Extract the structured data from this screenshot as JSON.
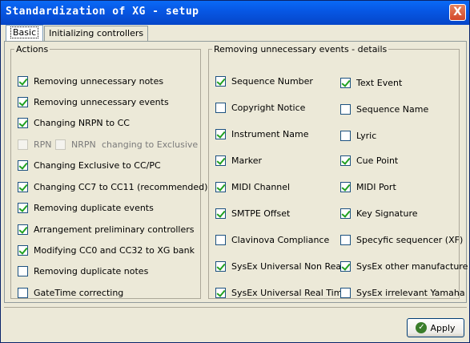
{
  "window": {
    "title": "Standardization of XG - setup",
    "close_label": "X"
  },
  "tabs": [
    {
      "label": "Basic",
      "active": true
    },
    {
      "label": "Initializing controllers",
      "active": false
    }
  ],
  "actions": {
    "legend": "Actions",
    "items": [
      {
        "label": "Removing unnecessary notes",
        "checked": true
      },
      {
        "label": "Removing unnecessary events",
        "checked": true
      },
      {
        "label": "Changing NRPN to CC",
        "checked": true
      },
      {
        "label": "RPN",
        "checked": false
      },
      {
        "label": "NRPN",
        "checked": false
      },
      {
        "label": "changing to Exclusive"
      },
      {
        "label": "Changing  Exclusive to CC/PC",
        "checked": true
      },
      {
        "label": "Changing CC7 to CC11 (recommended)",
        "checked": true
      },
      {
        "label": "Removing duplicate events",
        "checked": true
      },
      {
        "label": "Arrangement preliminary controllers",
        "checked": true
      },
      {
        "label": "Modifying CC0 and CC32 to XG bank",
        "checked": true
      },
      {
        "label": "Removing duplicate notes",
        "checked": false
      },
      {
        "label": "GateTime correcting",
        "checked": false
      }
    ]
  },
  "details": {
    "legend": "Removing unnecessary events - details",
    "left": [
      {
        "label": "Sequence Number",
        "checked": true
      },
      {
        "label": "Copyright Notice",
        "checked": false
      },
      {
        "label": "Instrument Name",
        "checked": true
      },
      {
        "label": "Marker",
        "checked": true
      },
      {
        "label": "MIDI Channel",
        "checked": true
      },
      {
        "label": "SMTPE Offset",
        "checked": true
      },
      {
        "label": "Clavinova Compliance",
        "checked": false
      },
      {
        "label": "SysEx Universal Non Real",
        "checked": true
      },
      {
        "label": "SysEx Universal Real Time",
        "checked": true
      }
    ],
    "right": [
      {
        "label": "Text Event",
        "checked": true
      },
      {
        "label": "Sequence Name",
        "checked": false
      },
      {
        "label": "Lyric",
        "checked": false
      },
      {
        "label": "Cue Point",
        "checked": true
      },
      {
        "label": "MIDI Port",
        "checked": true
      },
      {
        "label": "Key Signature",
        "checked": true
      },
      {
        "label": "Specyfic sequencer (XF)",
        "checked": false
      },
      {
        "label": "SysEx other manufacture",
        "checked": true
      },
      {
        "label": "SysEx irrelevant Yamaha",
        "checked": false
      }
    ]
  },
  "footer": {
    "apply_label": "Apply"
  }
}
